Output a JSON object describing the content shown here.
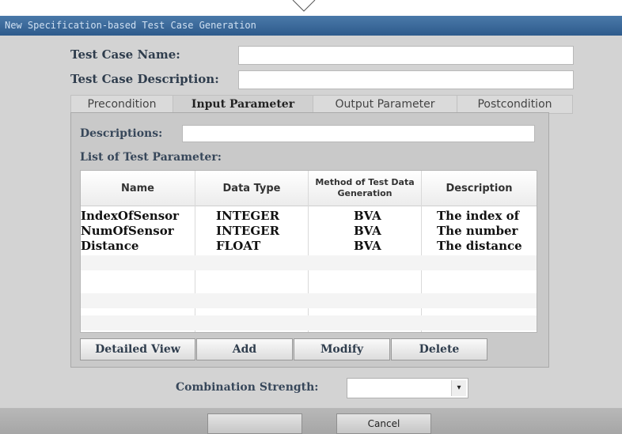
{
  "dialog": {
    "title": "New Specification-based Test Case Generation"
  },
  "form": {
    "name_label": "Test Case Name:",
    "name_value": "",
    "description_label": "Test Case Description:",
    "description_value": ""
  },
  "tabs": [
    {
      "label": "Precondition",
      "active": false
    },
    {
      "label": "Input Parameter",
      "active": true
    },
    {
      "label": "Output Parameter",
      "active": false
    },
    {
      "label": "Postcondition",
      "active": false
    }
  ],
  "panel": {
    "descriptions_label": "Descriptions:",
    "descriptions_value": "",
    "list_label": "List of Test Parameter:"
  },
  "table": {
    "columns": [
      "Name",
      "Data Type",
      "Method of Test Data Generation",
      "Description"
    ],
    "rows": [
      [
        "IndexOfSensor",
        "INTEGER",
        "BVA",
        "The index of"
      ],
      [
        "NumOfSensor",
        "INTEGER",
        "BVA",
        "The number"
      ],
      [
        "Distance",
        "FLOAT",
        "BVA",
        "The distance"
      ]
    ]
  },
  "actions": {
    "detailed_view": "Detailed View",
    "add": "Add",
    "modify": "Modify",
    "delete": "Delete"
  },
  "combination": {
    "label": "Combination Strength:",
    "value": ""
  },
  "footer": {
    "ok_label": "",
    "cancel_label": "Cancel"
  },
  "icons": {
    "dropdown": "chevron-down-icon",
    "pointer": "pointer-caret-icon"
  }
}
